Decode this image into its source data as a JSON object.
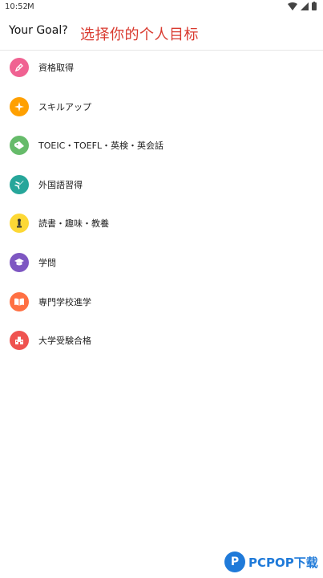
{
  "status_bar": {
    "time": "10:52",
    "mail_icon": "M"
  },
  "app_bar": {
    "title": "Your Goal?"
  },
  "overlay_caption": "选择你的个人目标",
  "goals": [
    {
      "label": "資格取得",
      "color": "#f06292",
      "icon": "pen-icon"
    },
    {
      "label": "スキルアップ",
      "color": "#ffa000",
      "icon": "sparkle-icon"
    },
    {
      "label": "TOEIC・TOEFL・英検・英会話",
      "color": "#66bb6a",
      "icon": "tag-icon"
    },
    {
      "label": "外国語習得",
      "color": "#26a69a",
      "icon": "airplane-icon"
    },
    {
      "label": "読書・趣味・教養",
      "color": "#fdd835",
      "icon": "chess-piece-icon"
    },
    {
      "label": "学問",
      "color": "#7e57c2",
      "icon": "graduation-cap-icon"
    },
    {
      "label": "専門学校進学",
      "color": "#ff7043",
      "icon": "open-book-icon"
    },
    {
      "label": "大学受験合格",
      "color": "#ef5350",
      "icon": "school-building-icon"
    }
  ],
  "watermark": {
    "logo_letter": "P",
    "text": "PCPOP下载"
  }
}
